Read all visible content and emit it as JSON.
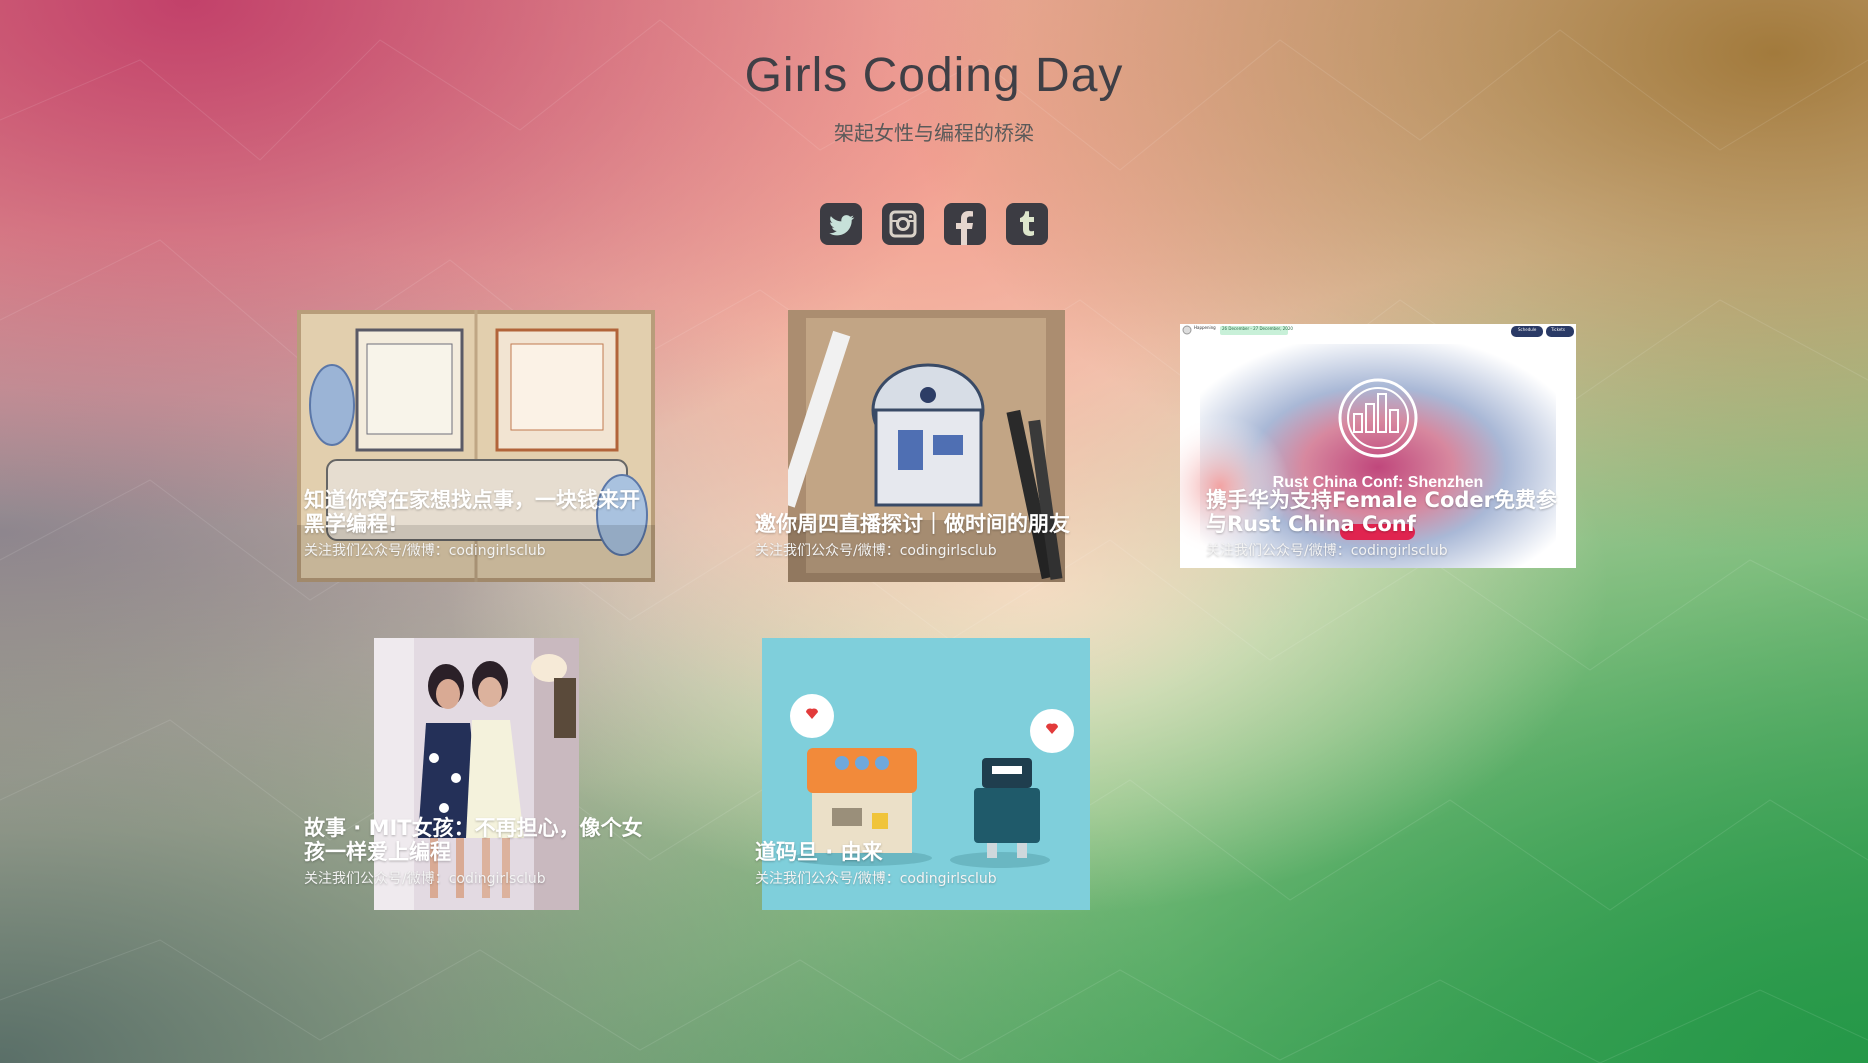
{
  "header": {
    "title": "Girls Coding Day",
    "subtitle": "架起女性与编程的桥梁"
  },
  "social": [
    {
      "name": "twitter-icon"
    },
    {
      "name": "instagram-icon"
    },
    {
      "name": "facebook-icon"
    },
    {
      "name": "tumblr-icon"
    }
  ],
  "articles": [
    {
      "title": "知道你窝在家想找点事，一块钱来开黑学编程!",
      "subtitle": "关注我们公众号/微博：codingirlsclub",
      "image": "notebook-drawing-computers-image"
    },
    {
      "title": "邀你周四直播探讨｜做时间的朋友",
      "subtitle": "关注我们公众号/微博：codingirlsclub",
      "image": "r2d2-sketch-image"
    },
    {
      "title": "携手华为支持Female Coder免费参与Rust China Conf",
      "subtitle": "关注我们公众号/微博：codingirlsclub",
      "image": "rust-conf-banner-image",
      "image_text": {
        "conf": "Rust China Conf: Shenzhen",
        "topbar_left": "Happening",
        "topbar_date": "26 December - 27 December, 2020",
        "topbar_btn1": "Schedule",
        "topbar_btn2": "Tickets"
      }
    },
    {
      "title": "故事 · MIT女孩：不再担心，像个女孩一样爱上编程",
      "subtitle": "关注我们公众号/微博：codingirlsclub",
      "image": "two-women-photo-image"
    },
    {
      "title": "道码旦 · 由来",
      "subtitle": "关注我们公众号/微博：codingirlsclub",
      "image": "robots-illustration-image"
    }
  ]
}
